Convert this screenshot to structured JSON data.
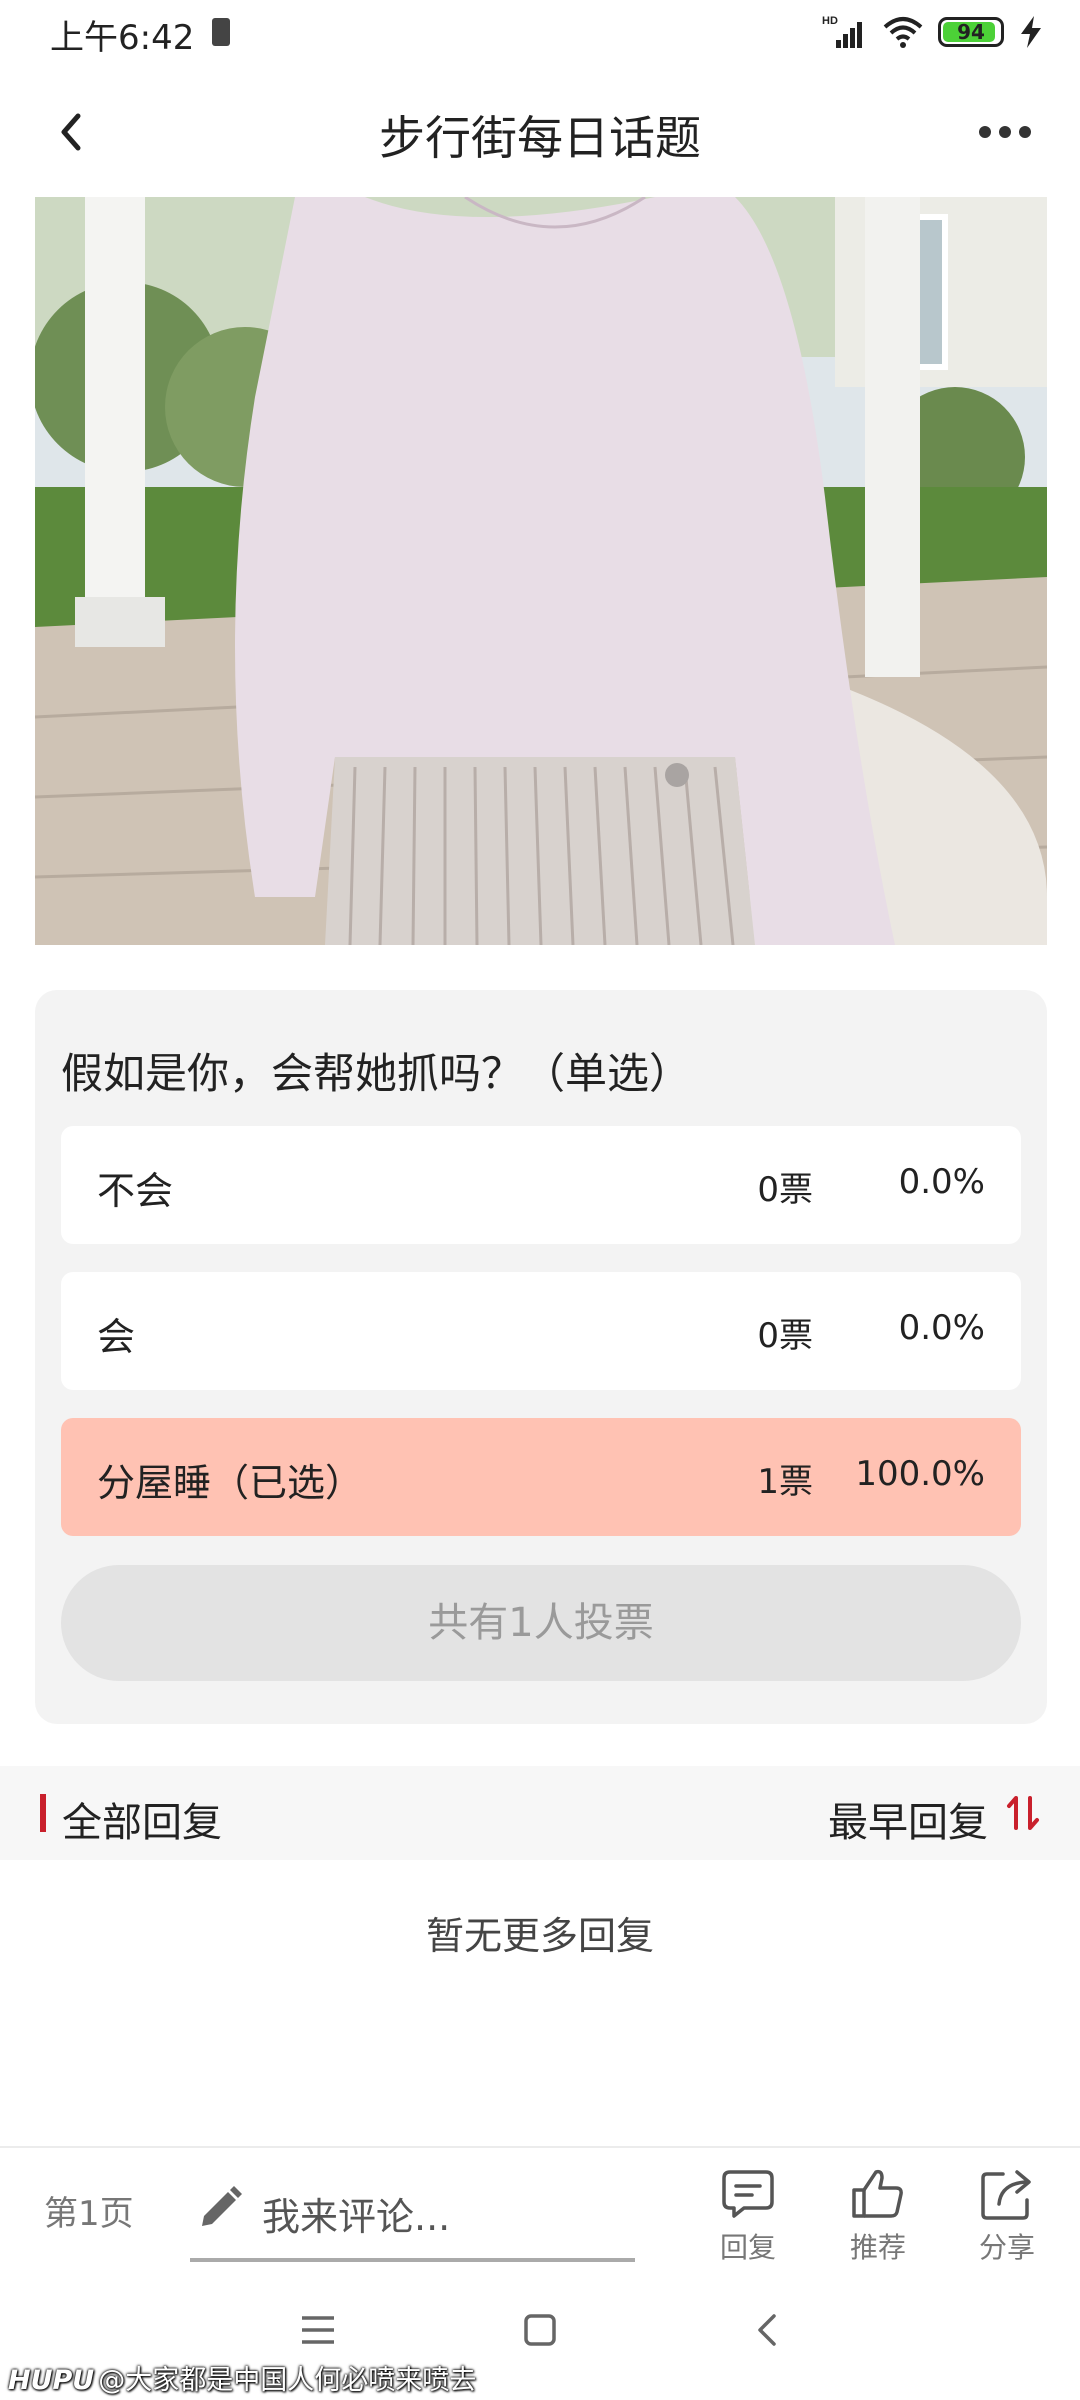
{
  "status_bar": {
    "time": "上午6:42",
    "battery": "94",
    "battery_level": 0.94,
    "network_type": "HD",
    "icons": [
      "battery-small-icon",
      "signal-icon",
      "wifi-icon",
      "battery-icon",
      "charging-icon"
    ]
  },
  "nav": {
    "title": "步行街每日话题",
    "back_icon": "back-icon",
    "more_icon": "more-icon"
  },
  "poll": {
    "question": "假如是你，会帮她抓吗？（单选）",
    "options": [
      {
        "label": "不会",
        "votes": "0票",
        "percent": "0.0%",
        "selected": false
      },
      {
        "label": "会",
        "votes": "0票",
        "percent": "0.0%",
        "selected": false
      },
      {
        "label": "分屋睡（已选）",
        "votes": "1票",
        "percent": "100.0%",
        "selected": true
      }
    ],
    "total": "共有1人投票"
  },
  "replies": {
    "title": "全部回复",
    "sort_label": "最早回复",
    "empty_text": "暂无更多回复"
  },
  "bottom_bar": {
    "page": "第1页",
    "comment_placeholder": "我来评论...",
    "actions": [
      {
        "label": "回复",
        "icon": "reply-icon"
      },
      {
        "label": "推荐",
        "icon": "thumbs-up-icon"
      },
      {
        "label": "分享",
        "icon": "share-icon"
      }
    ]
  },
  "watermark": {
    "brand": "HUPU",
    "text": "@大家都是中国人何必喷来喷去"
  },
  "colors": {
    "accent": "#c9202c",
    "selected_option": "#ffc2b3",
    "battery_green": "#4cd137"
  }
}
